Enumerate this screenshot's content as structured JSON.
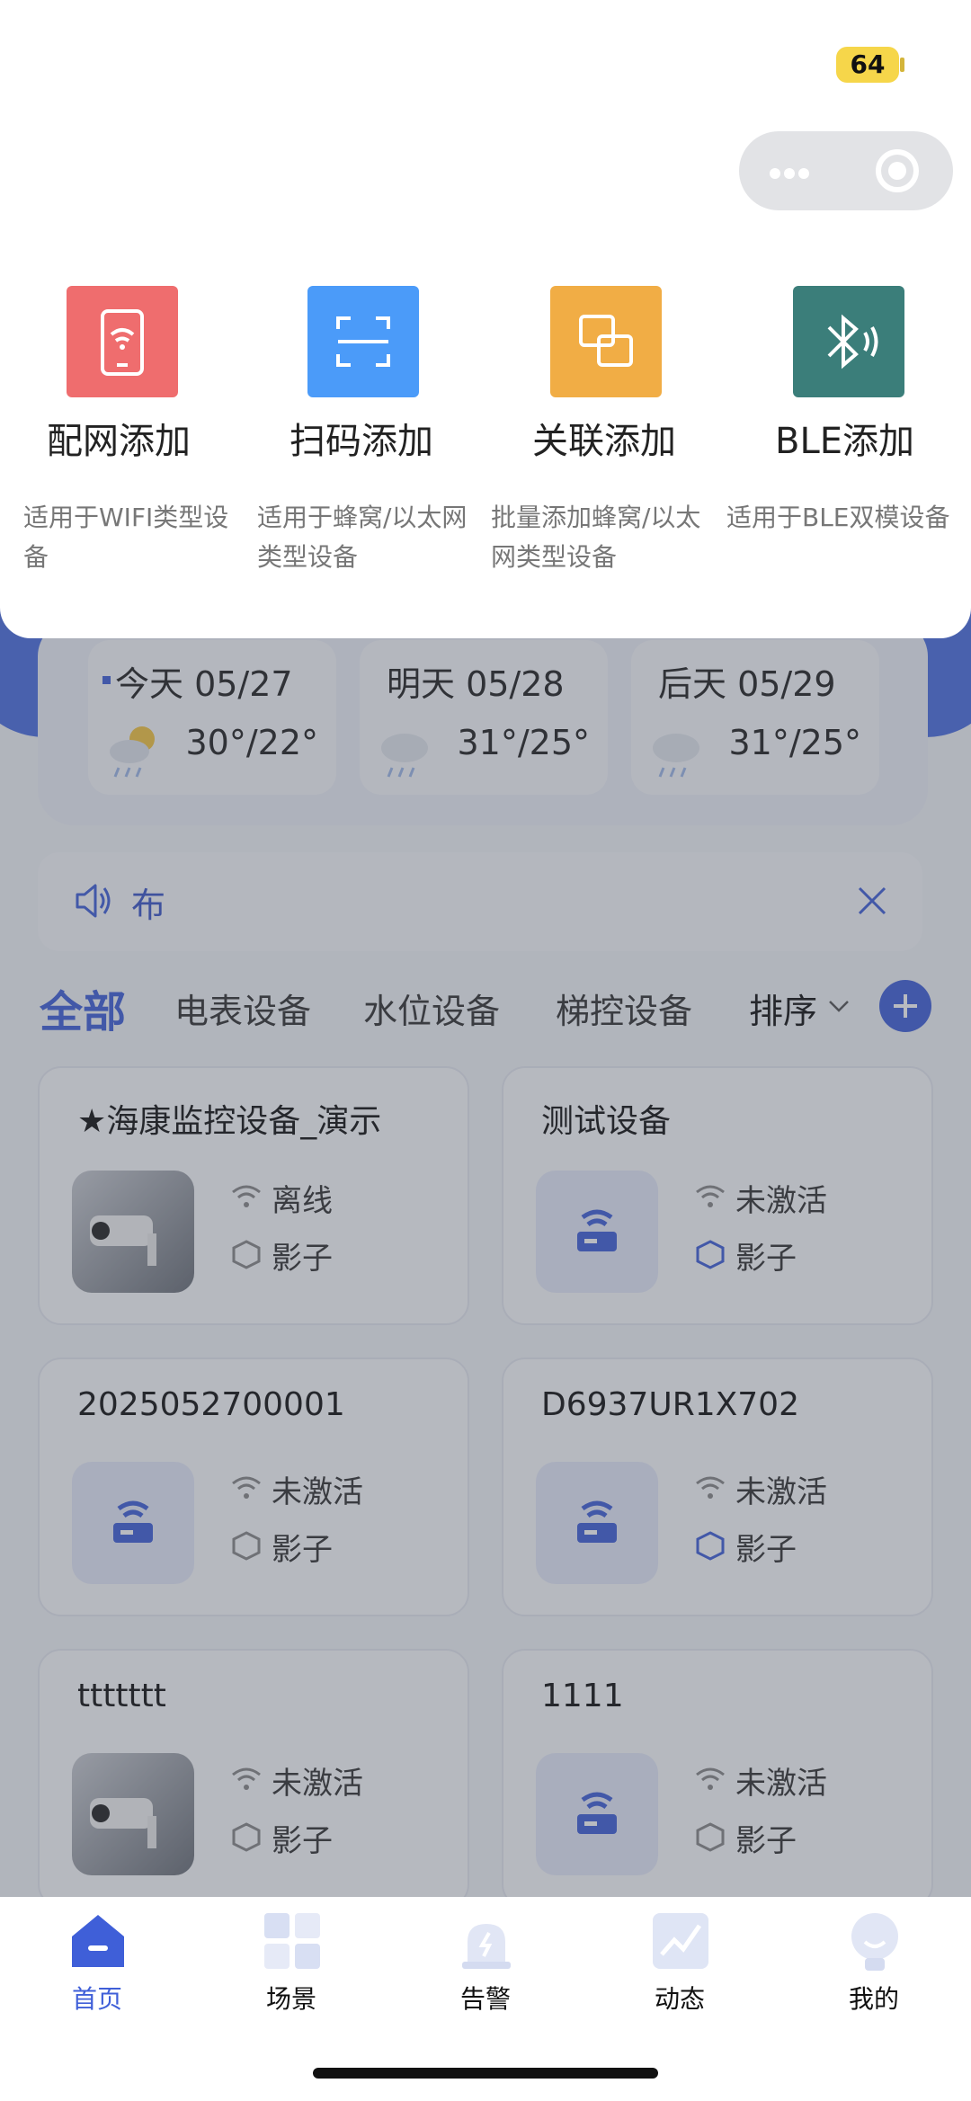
{
  "status_bar": {
    "battery": "64"
  },
  "add_menu": {
    "options": [
      {
        "label": "配网添加",
        "desc": "适用于WIFI类型设备",
        "color": "#ef6d6e",
        "icon": "phone-wifi-icon"
      },
      {
        "label": "扫码添加",
        "desc": "适用于蜂窝/以太网类型设备",
        "color": "#4b9bf9",
        "icon": "scan-icon"
      },
      {
        "label": "关联添加",
        "desc": "批量添加蜂窝/以太网类型设备",
        "color": "#f1ad45",
        "icon": "link-devices-icon"
      },
      {
        "label": "BLE添加",
        "desc": "适用于BLE双模设备",
        "color": "#3b7e7a",
        "icon": "bluetooth-icon"
      }
    ]
  },
  "weather": [
    {
      "day": "今天 05/27",
      "temp": "30°/22°",
      "icon": "partly-cloudy-rain-icon"
    },
    {
      "day": "明天 05/28",
      "temp": "31°/25°",
      "icon": "rain-icon"
    },
    {
      "day": "后天 05/29",
      "temp": "31°/25°",
      "icon": "rain-icon"
    }
  ],
  "notice": {
    "text": "布"
  },
  "tabs": {
    "items": [
      "全部",
      "电表设备",
      "水位设备",
      "梯控设备"
    ],
    "active": "全部",
    "sort": "排序"
  },
  "devices": [
    {
      "name": "★海康监控设备_演示",
      "status": "离线",
      "shadow": "影子",
      "thumb": "camera"
    },
    {
      "name": "测试设备",
      "status": "未激活",
      "shadow": "影子",
      "thumb": "router"
    },
    {
      "name": "2025052700001",
      "status": "未激活",
      "shadow": "影子",
      "thumb": "router"
    },
    {
      "name": "D6937UR1X702",
      "status": "未激活",
      "shadow": "影子",
      "thumb": "router"
    },
    {
      "name": "ttttttt",
      "status": "未激活",
      "shadow": "影子",
      "thumb": "camera"
    },
    {
      "name": "1111",
      "status": "未激活",
      "shadow": "影子",
      "thumb": "router"
    }
  ],
  "nav": [
    {
      "label": "首页",
      "icon": "home-icon",
      "active": true
    },
    {
      "label": "场景",
      "icon": "grid-icon",
      "active": false
    },
    {
      "label": "告警",
      "icon": "alarm-icon",
      "active": false
    },
    {
      "label": "动态",
      "icon": "trend-icon",
      "active": false
    },
    {
      "label": "我的",
      "icon": "profile-icon",
      "active": false
    }
  ],
  "colors": {
    "accent": "#3f5fd8",
    "battery": "#f6d64a"
  }
}
